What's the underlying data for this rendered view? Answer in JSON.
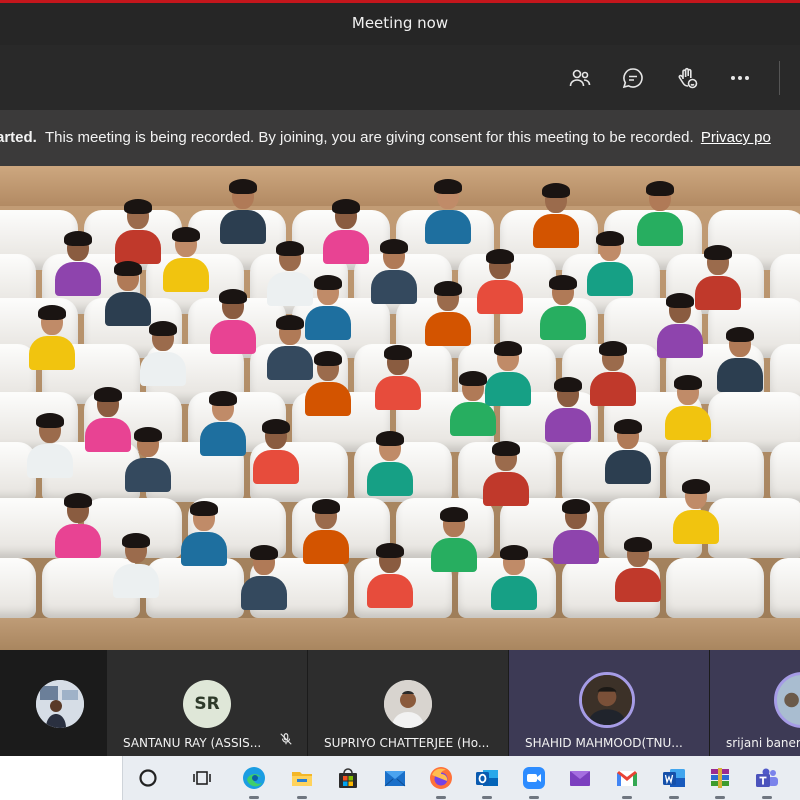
{
  "window": {
    "title": "Meeting now"
  },
  "toolbar": {
    "icons": [
      "participants-icon",
      "chat-icon",
      "raise-hand-icon",
      "more-options-icon"
    ]
  },
  "banner": {
    "prefix": "arted.",
    "message": "This meeting is being recorded. By joining, you are giving consent for this meeting to be recorded.",
    "link": "Privacy po"
  },
  "participants": [
    {
      "name": "",
      "initials": "",
      "avatar": "photo-avatar"
    },
    {
      "name": "SANTANU RAY (ASSIS...",
      "initials": "SR",
      "muted": true
    },
    {
      "name": "SUPRIYO CHATTERJEE (Ho...",
      "initials": "",
      "avatar": "photo-avatar"
    },
    {
      "name": "SHAHID MAHMOOD(TNU...",
      "initials": "",
      "avatar": "photo-avatar",
      "speaking": true
    },
    {
      "name": "srijani banerje",
      "initials": "",
      "avatar": "photo-avatar"
    }
  ],
  "colors": {
    "accent_red": "#c4161c",
    "speaking_ring": "#a69ce6",
    "speaking_tile": "#3d3a55",
    "initials_bg": "#dfe7d8"
  },
  "taskbar": {
    "apps": [
      "cortana-icon",
      "task-view-icon",
      "edge-icon",
      "file-explorer-icon",
      "store-icon",
      "mail-icon",
      "firefox-icon",
      "outlook-icon",
      "zoom-icon",
      "messenger-icon",
      "gmail-icon",
      "word-icon",
      "winrar-icon",
      "teams-icon"
    ]
  }
}
